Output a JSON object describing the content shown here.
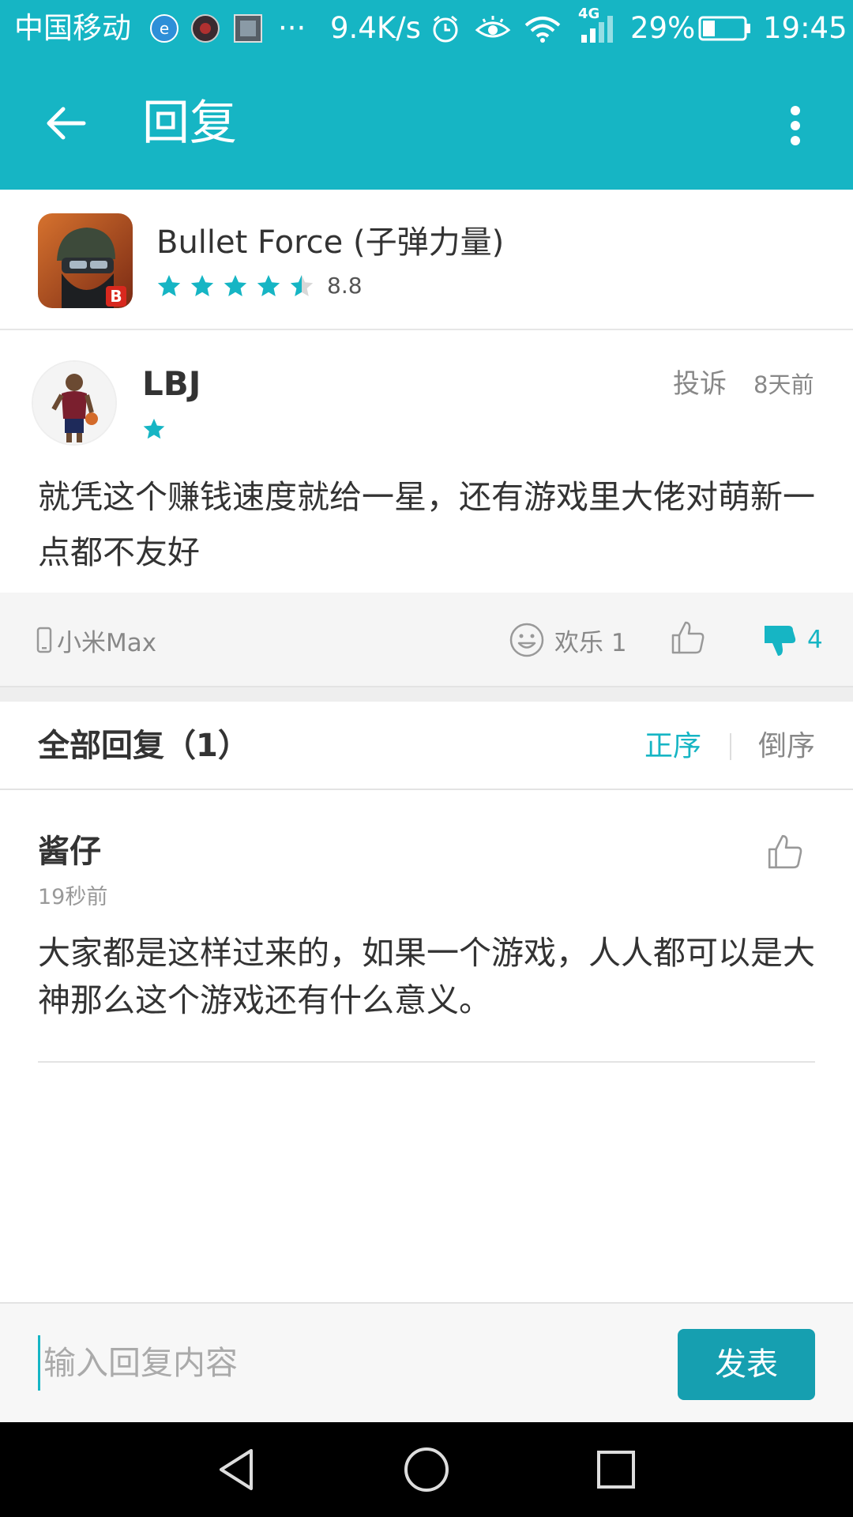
{
  "status_bar": {
    "carrier": "中国移动",
    "more": "···",
    "speed": "9.4K/s",
    "network": "4G",
    "battery": "29%",
    "time": "19:45"
  },
  "toolbar": {
    "title": "回复"
  },
  "app": {
    "name": "Bullet Force (子弹力量)",
    "rating": 4.5,
    "score": "8.8"
  },
  "review": {
    "user": "LBJ",
    "stars": 1,
    "report": "投诉",
    "time": "8天前",
    "text": "就凭这个赚钱速度就给一星，还有游戏里大佬对萌新一点都不友好"
  },
  "actions": {
    "device": "小米Max",
    "happy": "欢乐 1",
    "dislikes": "4"
  },
  "replies": {
    "title": "全部回复（1）",
    "sort_asc": "正序",
    "sort_desc": "倒序",
    "items": [
      {
        "user": "酱仔",
        "time": "19秒前",
        "text": "大家都是这样过来的，如果一个游戏，人人都可以是大神那么这个游戏还有什么意义。"
      }
    ]
  },
  "input": {
    "placeholder": "输入回复内容",
    "submit": "发表"
  },
  "colors": {
    "accent": "#16b5c4",
    "button": "#169fb0"
  }
}
